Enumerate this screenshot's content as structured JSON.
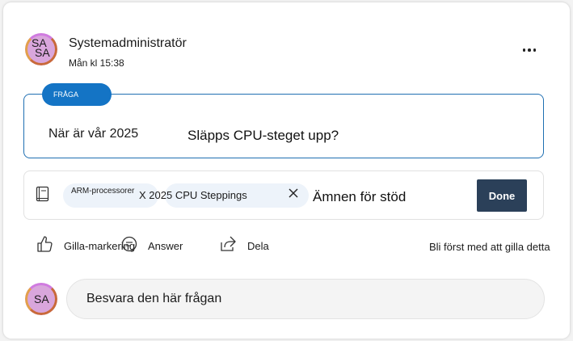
{
  "post": {
    "avatar_initials": "SA",
    "author": "Systemadministratör",
    "timestamp": "Mån kl 15:38"
  },
  "question": {
    "badge": "FRÅGA",
    "text_part1": "När är vår 2025",
    "text_part2": "Släpps CPU-steget upp?"
  },
  "topics": {
    "chips": [
      {
        "label": "ARM-processorer"
      },
      {
        "label": "X 2025 CPU Steppings"
      }
    ],
    "placeholder": "Ämnen för stöd",
    "done_label": "Done"
  },
  "actions": {
    "like_label": "Gilla-markering",
    "answer_label": "Answer",
    "share_label": "Dela",
    "like_prompt": "Bli först med att gilla detta"
  },
  "reply": {
    "avatar_initials": "SA",
    "placeholder": "Besvara den här frågan"
  },
  "colors": {
    "accent": "#1474c5",
    "done_button": "#2b4059",
    "avatar": "#d9a6dc"
  }
}
